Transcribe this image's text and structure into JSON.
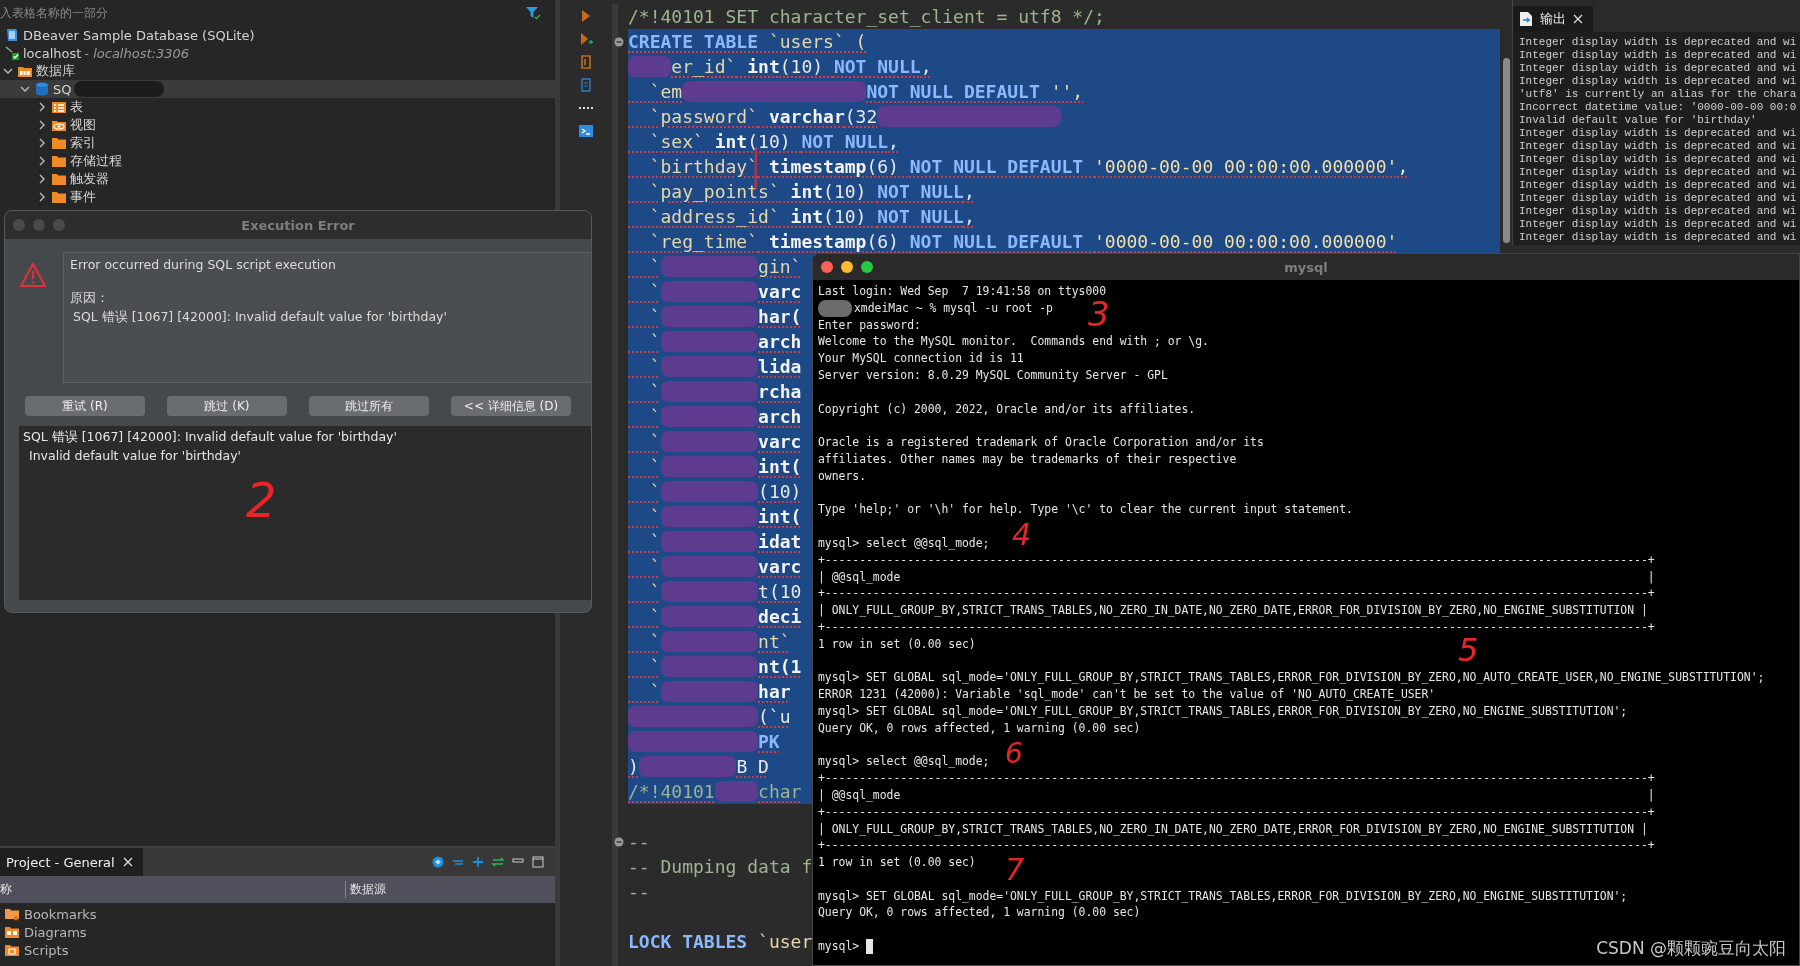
{
  "navigator": {
    "filter": {
      "placeholder": "入表格名称的一部分"
    },
    "tree": [
      {
        "kind": "datasource",
        "label": "DBeaver Sample Database (SQLite)",
        "selected": false
      },
      {
        "kind": "connection",
        "label": "localhost",
        "detail": " - localhost:3306",
        "selected": false,
        "children": [
          {
            "kind": "databases",
            "label": "数据库",
            "expanded": true,
            "selected": false,
            "children": [
              {
                "kind": "schema",
                "label": "SQ",
                "expanded": true,
                "selected": true,
                "redacted": true,
                "children": [
                  {
                    "kind": "tables",
                    "label": "表",
                    "expanded": false,
                    "selected": false
                  },
                  {
                    "kind": "views",
                    "label": "视图",
                    "expanded": false,
                    "selected": false
                  },
                  {
                    "kind": "folder",
                    "label": "索引",
                    "expanded": false,
                    "selected": false
                  },
                  {
                    "kind": "folder",
                    "label": "存储过程",
                    "expanded": false,
                    "selected": false
                  },
                  {
                    "kind": "folder",
                    "label": "触发器",
                    "expanded": false,
                    "selected": false
                  },
                  {
                    "kind": "folder",
                    "label": "事件",
                    "expanded": false,
                    "selected": false
                  }
                ]
              }
            ]
          }
        ]
      }
    ]
  },
  "dialog": {
    "title": "Execution Error",
    "message": "Error occurred during SQL script execution",
    "reason_label": "原因：",
    "reason": "SQL 错误 [1067] [42000]: Invalid default value for 'birthday'",
    "buttons": [
      "重试 (R)",
      "跳过 (K)",
      "跳过所有",
      "<< 详细信息 (D)"
    ],
    "details": [
      "SQL 错误 [1067] [42000]: Invalid default value for 'birthday'",
      "Invalid default value for 'birthday'"
    ]
  },
  "project": {
    "tab": "Project - General",
    "columns": [
      "称",
      "数据源"
    ],
    "items": [
      {
        "kind": "bookmarks",
        "label": "Bookmarks"
      },
      {
        "kind": "diagrams",
        "label": "Diagrams"
      },
      {
        "kind": "scripts",
        "label": "Scripts"
      }
    ]
  },
  "editor": {
    "lines": [
      {
        "selected": false,
        "segments": [
          {
            "kind": "comment",
            "text": "/*!40101 SET character_set_client = utf8 */;"
          }
        ]
      },
      {
        "selected": true,
        "collapsible": true,
        "segments": [
          {
            "kind": "keyword",
            "text": "CREATE TABLE "
          },
          {
            "kind": "ident",
            "text": "`users` ("
          }
        ]
      },
      {
        "selected": true,
        "segments": [
          {
            "kind": "redact-s"
          },
          {
            "kind": "ident",
            "text": "er_id`"
          },
          {
            "kind": "type",
            "text": " int"
          },
          {
            "kind": "plain",
            "text": "(10) "
          },
          {
            "kind": "keyword",
            "text": "NOT NULL"
          },
          {
            "kind": "plain",
            "text": ","
          }
        ]
      },
      {
        "selected": true,
        "segments": [
          {
            "kind": "ident",
            "text": "  `em"
          },
          {
            "kind": "redact-l"
          },
          {
            "kind": "keyword",
            "text": "NOT NULL DEFAULT "
          },
          {
            "kind": "string",
            "text": "'',"
          }
        ]
      },
      {
        "selected": true,
        "segments": [
          {
            "kind": "ident",
            "text": "  `password`"
          },
          {
            "kind": "type",
            "text": " varchar"
          },
          {
            "kind": "plain",
            "text": "(32"
          },
          {
            "kind": "redact-l"
          }
        ]
      },
      {
        "selected": true,
        "segments": [
          {
            "kind": "ident",
            "text": "  `sex`"
          },
          {
            "kind": "type",
            "text": " int"
          },
          {
            "kind": "plain",
            "text": "(10) "
          },
          {
            "kind": "keyword",
            "text": "NOT NULL"
          },
          {
            "kind": "plain",
            "text": ","
          }
        ]
      },
      {
        "selected": true,
        "segments": [
          {
            "kind": "ident",
            "text": "  `birthday`"
          },
          {
            "kind": "type",
            "text": " timestamp"
          },
          {
            "kind": "plain",
            "text": "(6) "
          },
          {
            "kind": "keyword",
            "text": "NOT NULL DEFAULT "
          },
          {
            "kind": "string",
            "text": "'0000-00-00 00:00:00.000000'"
          },
          {
            "kind": "plain",
            "text": ","
          }
        ]
      },
      {
        "selected": true,
        "segments": [
          {
            "kind": "ident",
            "text": "  `pay_points`"
          },
          {
            "kind": "type",
            "text": " int"
          },
          {
            "kind": "plain",
            "text": "(10) "
          },
          {
            "kind": "keyword",
            "text": "NOT NULL"
          },
          {
            "kind": "plain",
            "text": ","
          }
        ]
      },
      {
        "selected": true,
        "segments": [
          {
            "kind": "ident",
            "text": "  `address_id`"
          },
          {
            "kind": "type",
            "text": " int"
          },
          {
            "kind": "plain",
            "text": "(10) "
          },
          {
            "kind": "keyword",
            "text": "NOT NULL"
          },
          {
            "kind": "plain",
            "text": ","
          }
        ]
      },
      {
        "selected": true,
        "segments": [
          {
            "kind": "ident",
            "text": "  `reg_time`"
          },
          {
            "kind": "type",
            "text": " timestamp"
          },
          {
            "kind": "plain",
            "text": "(6) "
          },
          {
            "kind": "keyword",
            "text": "NOT NULL DEFAULT "
          },
          {
            "kind": "string",
            "text": "'0000-00-00 00:00:00.000000'"
          }
        ]
      },
      {
        "selected": true,
        "segments": [
          {
            "kind": "ident",
            "text": "  `"
          },
          {
            "kind": "redact-m"
          },
          {
            "kind": "ident",
            "text": "gin`"
          }
        ]
      },
      {
        "selected": true,
        "segments": [
          {
            "kind": "ident",
            "text": "  `"
          },
          {
            "kind": "redact-m"
          },
          {
            "kind": "type",
            "text": "varc"
          }
        ]
      },
      {
        "selected": true,
        "segments": [
          {
            "kind": "ident",
            "text": "  `"
          },
          {
            "kind": "redact-m"
          },
          {
            "kind": "type",
            "text": "har("
          }
        ]
      },
      {
        "selected": true,
        "segments": [
          {
            "kind": "ident",
            "text": "  `"
          },
          {
            "kind": "redact-m"
          },
          {
            "kind": "type",
            "text": "arch"
          }
        ]
      },
      {
        "selected": true,
        "segments": [
          {
            "kind": "ident",
            "text": "  `"
          },
          {
            "kind": "redact-m"
          },
          {
            "kind": "type",
            "text": "lida"
          }
        ]
      },
      {
        "selected": true,
        "segments": [
          {
            "kind": "ident",
            "text": "  `"
          },
          {
            "kind": "redact-m"
          },
          {
            "kind": "type",
            "text": "rcha"
          }
        ]
      },
      {
        "selected": true,
        "segments": [
          {
            "kind": "ident",
            "text": "  `"
          },
          {
            "kind": "redact-m"
          },
          {
            "kind": "type",
            "text": "arch"
          }
        ]
      },
      {
        "selected": true,
        "segments": [
          {
            "kind": "ident",
            "text": "  `"
          },
          {
            "kind": "redact-m"
          },
          {
            "kind": "type",
            "text": "varc"
          }
        ]
      },
      {
        "selected": true,
        "segments": [
          {
            "kind": "ident",
            "text": "  `"
          },
          {
            "kind": "redact-m"
          },
          {
            "kind": "type",
            "text": "int("
          }
        ]
      },
      {
        "selected": true,
        "segments": [
          {
            "kind": "ident",
            "text": "  `"
          },
          {
            "kind": "redact-m"
          },
          {
            "kind": "plain",
            "text": "(10)"
          }
        ]
      },
      {
        "selected": true,
        "segments": [
          {
            "kind": "ident",
            "text": "  `"
          },
          {
            "kind": "redact-m"
          },
          {
            "kind": "type",
            "text": "int("
          }
        ]
      },
      {
        "selected": true,
        "segments": [
          {
            "kind": "ident",
            "text": "  `"
          },
          {
            "kind": "redact-m"
          },
          {
            "kind": "type",
            "text": "idat"
          }
        ]
      },
      {
        "selected": true,
        "segments": [
          {
            "kind": "ident",
            "text": "  `"
          },
          {
            "kind": "redact-m"
          },
          {
            "kind": "type",
            "text": "varc"
          }
        ]
      },
      {
        "selected": true,
        "segments": [
          {
            "kind": "ident",
            "text": "  `"
          },
          {
            "kind": "redact-m"
          },
          {
            "kind": "plain",
            "text": "t(10"
          }
        ]
      },
      {
        "selected": true,
        "segments": [
          {
            "kind": "ident",
            "text": "  `"
          },
          {
            "kind": "redact-m"
          },
          {
            "kind": "type",
            "text": "deci"
          }
        ]
      },
      {
        "selected": true,
        "segments": [
          {
            "kind": "ident",
            "text": "  `"
          },
          {
            "kind": "redact-m"
          },
          {
            "kind": "ident",
            "text": "nt`"
          }
        ]
      },
      {
        "selected": true,
        "segments": [
          {
            "kind": "ident",
            "text": "  `"
          },
          {
            "kind": "redact-m"
          },
          {
            "kind": "type",
            "text": "nt(1"
          }
        ]
      },
      {
        "selected": true,
        "segments": [
          {
            "kind": "ident",
            "text": "  `"
          },
          {
            "kind": "redact-m"
          },
          {
            "kind": "type",
            "text": "har"
          }
        ]
      },
      {
        "selected": true,
        "segments": [
          {
            "kind": "redact-w"
          },
          {
            "kind": "plain",
            "text": "(`u"
          }
        ]
      },
      {
        "selected": true,
        "segments": [
          {
            "kind": "redact-w"
          },
          {
            "kind": "keyword",
            "text": "PK"
          }
        ]
      },
      {
        "selected": true,
        "segments": [
          {
            "kind": "plain",
            "text": ")"
          },
          {
            "kind": "redact-m"
          },
          {
            "kind": "plain",
            "text": "B D"
          }
        ]
      },
      {
        "selected": true,
        "segments": [
          {
            "kind": "comment",
            "text": "/*!40101"
          },
          {
            "kind": "redact-s"
          },
          {
            "kind": "comment",
            "text": "char"
          }
        ]
      },
      {
        "selected": false
      },
      {
        "selected": false,
        "collapsible": true,
        "segments": [
          {
            "kind": "comment",
            "text": "--"
          }
        ]
      },
      {
        "selected": false,
        "segments": [
          {
            "kind": "comment",
            "text": "-- Dumping data f"
          }
        ]
      },
      {
        "selected": false,
        "segments": [
          {
            "kind": "comment",
            "text": "--"
          }
        ]
      },
      {
        "selected": false
      },
      {
        "selected": false,
        "segments": [
          {
            "kind": "keyword",
            "text": "LOCK TABLES "
          },
          {
            "kind": "ident",
            "text": "`user"
          }
        ]
      }
    ]
  },
  "output": {
    "tab": "输出",
    "lines": [
      "Integer display width is deprecated and wi",
      "Integer display width is deprecated and wi",
      "Integer display width is deprecated and wi",
      "Integer display width is deprecated and wi",
      "'utf8' is currently an alias for the chara",
      "Incorrect datetime value: '0000-00-00 00:0",
      "Invalid default value for 'birthday'",
      "Integer display width is deprecated and wi",
      "Integer display width is deprecated and wi",
      "Integer display width is deprecated and wi",
      "Integer display width is deprecated and wi",
      "Integer display width is deprecated and wi",
      "Integer display width is deprecated and wi",
      "Integer display width is deprecated and wi",
      "Integer display width is deprecated and wi",
      "Integer display width is deprecated and wi"
    ]
  },
  "terminal": {
    "title": "mysql",
    "lines": [
      {
        "kind": "text",
        "text": "Last login: Wed Sep  7 19:41:58 on ttys000"
      },
      {
        "kind": "redacted",
        "text": "xmdeiMac ~ % mysql -u root -p"
      },
      {
        "kind": "text",
        "text": "Enter password:"
      },
      {
        "kind": "text",
        "text": "Welcome to the MySQL monitor.  Commands end with ; or \\g."
      },
      {
        "kind": "text",
        "text": "Your MySQL connection id is 11"
      },
      {
        "kind": "text",
        "text": "Server version: 8.0.29 MySQL Community Server - GPL"
      },
      {
        "kind": "blank"
      },
      {
        "kind": "text",
        "text": "Copyright (c) 2000, 2022, Oracle and/or its affiliates."
      },
      {
        "kind": "blank"
      },
      {
        "kind": "text",
        "text": "Oracle is a registered trademark of Oracle Corporation and/or its"
      },
      {
        "kind": "text",
        "text": "affiliates. Other names may be trademarks of their respective"
      },
      {
        "kind": "text",
        "text": "owners."
      },
      {
        "kind": "blank"
      },
      {
        "kind": "text",
        "text": "Type 'help;' or '\\h' for help. Type '\\c' to clear the current input statement."
      },
      {
        "kind": "blank"
      },
      {
        "kind": "text",
        "text": "mysql> select @@sql_mode;"
      },
      {
        "kind": "text",
        "text": "+------------------------------------------------------------------------------------------------------------------------+"
      },
      {
        "kind": "text",
        "text": "| @@sql_mode                                                                                                             |"
      },
      {
        "kind": "text",
        "text": "+------------------------------------------------------------------------------------------------------------------------+"
      },
      {
        "kind": "text",
        "text": "| ONLY_FULL_GROUP_BY,STRICT_TRANS_TABLES,NO_ZERO_IN_DATE,NO_ZERO_DATE,ERROR_FOR_DIVISION_BY_ZERO,NO_ENGINE_SUBSTITUTION |"
      },
      {
        "kind": "text",
        "text": "+------------------------------------------------------------------------------------------------------------------------+"
      },
      {
        "kind": "text",
        "text": "1 row in set (0.00 sec)"
      },
      {
        "kind": "blank"
      },
      {
        "kind": "text",
        "text": "mysql> SET GLOBAL sql_mode='ONLY_FULL_GROUP_BY,STRICT_TRANS_TABLES,ERROR_FOR_DIVISION_BY_ZERO,NO_AUTO_CREATE_USER,NO_ENGINE_SUBSTITUTION';"
      },
      {
        "kind": "text",
        "text": "ERROR 1231 (42000): Variable 'sql_mode' can't be set to the value of 'NO_AUTO_CREATE_USER'"
      },
      {
        "kind": "text",
        "text": "mysql> SET GLOBAL sql_mode='ONLY_FULL_GROUP_BY,STRICT_TRANS_TABLES,ERROR_FOR_DIVISION_BY_ZERO,NO_ENGINE_SUBSTITUTION';"
      },
      {
        "kind": "text",
        "text": "Query OK, 0 rows affected, 1 warning (0.00 sec)"
      },
      {
        "kind": "blank"
      },
      {
        "kind": "text",
        "text": "mysql> select @@sql_mode;"
      },
      {
        "kind": "text",
        "text": "+------------------------------------------------------------------------------------------------------------------------+"
      },
      {
        "kind": "text",
        "text": "| @@sql_mode                                                                                                             |"
      },
      {
        "kind": "text",
        "text": "+------------------------------------------------------------------------------------------------------------------------+"
      },
      {
        "kind": "text",
        "text": "| ONLY_FULL_GROUP_BY,STRICT_TRANS_TABLES,NO_ZERO_IN_DATE,NO_ZERO_DATE,ERROR_FOR_DIVISION_BY_ZERO,NO_ENGINE_SUBSTITUTION |"
      },
      {
        "kind": "text",
        "text": "+------------------------------------------------------------------------------------------------------------------------+"
      },
      {
        "kind": "text",
        "text": "1 row in set (0.00 sec)"
      },
      {
        "kind": "blank"
      },
      {
        "kind": "text",
        "text": "mysql> SET GLOBAL sql_mode='ONLY_FULL_GROUP_BY,STRICT_TRANS_TABLES,ERROR_FOR_DIVISION_BY_ZERO,NO_ENGINE_SUBSTITUTION';"
      },
      {
        "kind": "text",
        "text": "Query OK, 0 rows affected, 1 warning (0.00 sec)"
      },
      {
        "kind": "blank"
      },
      {
        "kind": "prompt",
        "text": "mysql>"
      }
    ]
  },
  "annotations": [
    "2",
    "3",
    "4",
    "5",
    "6",
    "7"
  ],
  "watermark": "CSDN @颗颗豌豆向太阳"
}
